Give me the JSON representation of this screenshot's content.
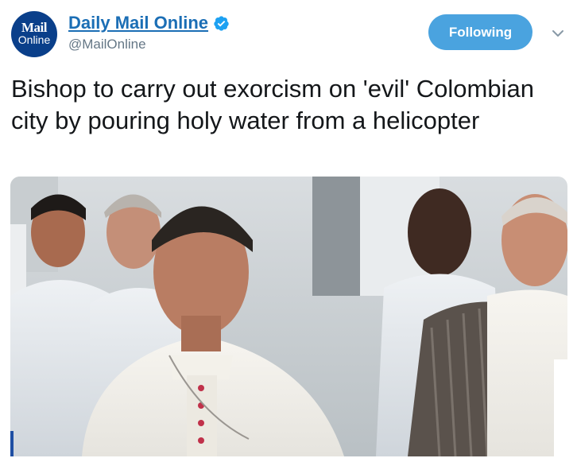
{
  "account": {
    "avatar_line1": "Mail",
    "avatar_line2": "Online",
    "display_name": "Daily Mail Online",
    "handle": "@MailOnline",
    "verified": true
  },
  "actions": {
    "follow_label": "Following"
  },
  "tweet": {
    "text": "Bishop to carry out exorcism on 'evil' Colombian city by pouring holy water from a helicopter"
  },
  "media": {
    "description_icon": "photo-thumbnail"
  },
  "colors": {
    "link_blue": "#1b6eb5",
    "follow_button": "#4aa3df",
    "verified_badge": "#1da1f2",
    "text": "#14171a",
    "handle_gray": "#657786",
    "avatar_bg": "#0a3f8a"
  },
  "icons": {
    "verified": "verified-badge-icon",
    "caret": "chevron-down-icon"
  }
}
